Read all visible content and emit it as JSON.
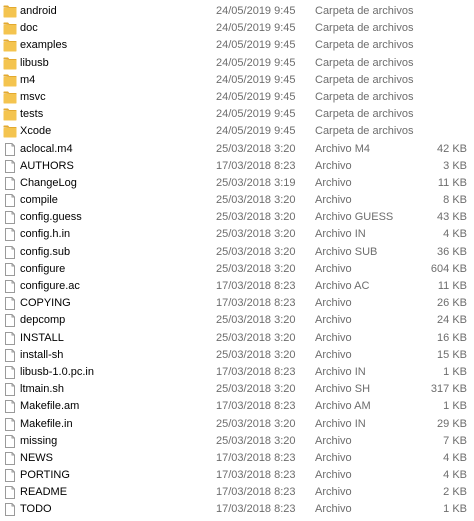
{
  "colors": {
    "folder_fill": "#f4c44f",
    "folder_tab": "#e3a92e",
    "file_fill": "#ffffff",
    "file_border": "#9a9a9a",
    "meta_text": "#6d6d6d",
    "name_text": "#000000"
  },
  "icons": {
    "folder": "folder-icon",
    "file": "file-icon"
  },
  "file_list": {
    "items": [
      {
        "name": "android",
        "date": "24/05/2019 9:45",
        "type": "Carpeta de archivos",
        "size": "",
        "icon": "folder-icon"
      },
      {
        "name": "doc",
        "date": "24/05/2019 9:45",
        "type": "Carpeta de archivos",
        "size": "",
        "icon": "folder-icon"
      },
      {
        "name": "examples",
        "date": "24/05/2019 9:45",
        "type": "Carpeta de archivos",
        "size": "",
        "icon": "folder-icon"
      },
      {
        "name": "libusb",
        "date": "24/05/2019 9:45",
        "type": "Carpeta de archivos",
        "size": "",
        "icon": "folder-icon"
      },
      {
        "name": "m4",
        "date": "24/05/2019 9:45",
        "type": "Carpeta de archivos",
        "size": "",
        "icon": "folder-icon"
      },
      {
        "name": "msvc",
        "date": "24/05/2019 9:45",
        "type": "Carpeta de archivos",
        "size": "",
        "icon": "folder-icon"
      },
      {
        "name": "tests",
        "date": "24/05/2019 9:45",
        "type": "Carpeta de archivos",
        "size": "",
        "icon": "folder-icon"
      },
      {
        "name": "Xcode",
        "date": "24/05/2019 9:45",
        "type": "Carpeta de archivos",
        "size": "",
        "icon": "folder-icon"
      },
      {
        "name": "aclocal.m4",
        "date": "25/03/2018 3:20",
        "type": "Archivo M4",
        "size": "42 KB",
        "icon": "file-icon"
      },
      {
        "name": "AUTHORS",
        "date": "17/03/2018 8:23",
        "type": "Archivo",
        "size": "3 KB",
        "icon": "file-icon"
      },
      {
        "name": "ChangeLog",
        "date": "25/03/2018 3:19",
        "type": "Archivo",
        "size": "11 KB",
        "icon": "file-icon"
      },
      {
        "name": "compile",
        "date": "25/03/2018 3:20",
        "type": "Archivo",
        "size": "8 KB",
        "icon": "file-icon"
      },
      {
        "name": "config.guess",
        "date": "25/03/2018 3:20",
        "type": "Archivo GUESS",
        "size": "43 KB",
        "icon": "file-icon"
      },
      {
        "name": "config.h.in",
        "date": "25/03/2018 3:20",
        "type": "Archivo IN",
        "size": "4 KB",
        "icon": "file-icon"
      },
      {
        "name": "config.sub",
        "date": "25/03/2018 3:20",
        "type": "Archivo SUB",
        "size": "36 KB",
        "icon": "file-icon"
      },
      {
        "name": "configure",
        "date": "25/03/2018 3:20",
        "type": "Archivo",
        "size": "604 KB",
        "icon": "file-icon"
      },
      {
        "name": "configure.ac",
        "date": "17/03/2018 8:23",
        "type": "Archivo AC",
        "size": "11 KB",
        "icon": "file-icon"
      },
      {
        "name": "COPYING",
        "date": "17/03/2018 8:23",
        "type": "Archivo",
        "size": "26 KB",
        "icon": "file-icon"
      },
      {
        "name": "depcomp",
        "date": "25/03/2018 3:20",
        "type": "Archivo",
        "size": "24 KB",
        "icon": "file-icon"
      },
      {
        "name": "INSTALL",
        "date": "25/03/2018 3:20",
        "type": "Archivo",
        "size": "16 KB",
        "icon": "file-icon"
      },
      {
        "name": "install-sh",
        "date": "25/03/2018 3:20",
        "type": "Archivo",
        "size": "15 KB",
        "icon": "file-icon"
      },
      {
        "name": "libusb-1.0.pc.in",
        "date": "17/03/2018 8:23",
        "type": "Archivo IN",
        "size": "1 KB",
        "icon": "file-icon"
      },
      {
        "name": "ltmain.sh",
        "date": "25/03/2018 3:20",
        "type": "Archivo SH",
        "size": "317 KB",
        "icon": "file-icon"
      },
      {
        "name": "Makefile.am",
        "date": "17/03/2018 8:23",
        "type": "Archivo AM",
        "size": "1 KB",
        "icon": "file-icon"
      },
      {
        "name": "Makefile.in",
        "date": "25/03/2018 3:20",
        "type": "Archivo IN",
        "size": "29 KB",
        "icon": "file-icon"
      },
      {
        "name": "missing",
        "date": "25/03/2018 3:20",
        "type": "Archivo",
        "size": "7 KB",
        "icon": "file-icon"
      },
      {
        "name": "NEWS",
        "date": "17/03/2018 8:23",
        "type": "Archivo",
        "size": "4 KB",
        "icon": "file-icon"
      },
      {
        "name": "PORTING",
        "date": "17/03/2018 8:23",
        "type": "Archivo",
        "size": "4 KB",
        "icon": "file-icon"
      },
      {
        "name": "README",
        "date": "17/03/2018 8:23",
        "type": "Archivo",
        "size": "2 KB",
        "icon": "file-icon"
      },
      {
        "name": "TODO",
        "date": "17/03/2018 8:23",
        "type": "Archivo",
        "size": "1 KB",
        "icon": "file-icon"
      }
    ]
  }
}
